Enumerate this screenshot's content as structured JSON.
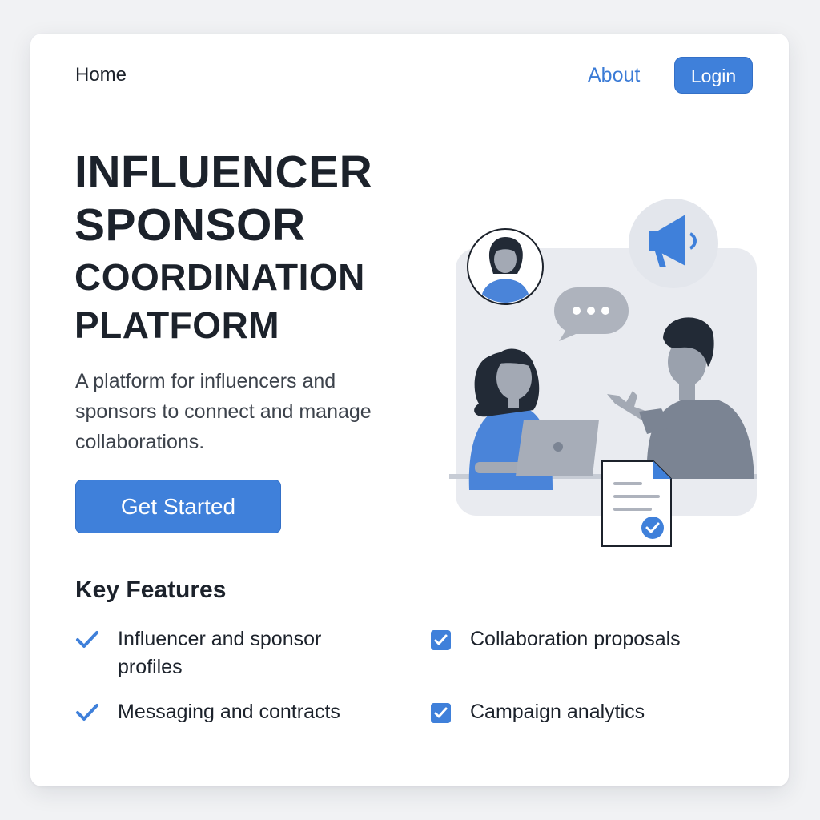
{
  "nav": {
    "home_label": "Home",
    "about_label": "About",
    "login_label": "Login"
  },
  "hero": {
    "title_lines": [
      "INFLUENCER",
      "SPONSOR",
      "COORDINATION",
      "PLATFORM"
    ],
    "description": "A platform for influencers and sponsors to connect and manage collaborations.",
    "cta_label": "Get Started"
  },
  "features": {
    "heading": "Key Features",
    "items": [
      {
        "label": "Influencer and sponsor profiles",
        "icon": "checkmark-icon"
      },
      {
        "label": "Collaboration proposals",
        "icon": "checkbox-icon"
      },
      {
        "label": "Messaging and contracts",
        "icon": "checkmark-icon"
      },
      {
        "label": "Campaign analytics",
        "icon": "checkbox-icon"
      }
    ]
  },
  "colors": {
    "accent": "#3f80da",
    "text": "#1c222b",
    "muted_text": "#3c424b",
    "illustration_gray": "#7b8493",
    "panel_bg": "#e9ebf0"
  }
}
